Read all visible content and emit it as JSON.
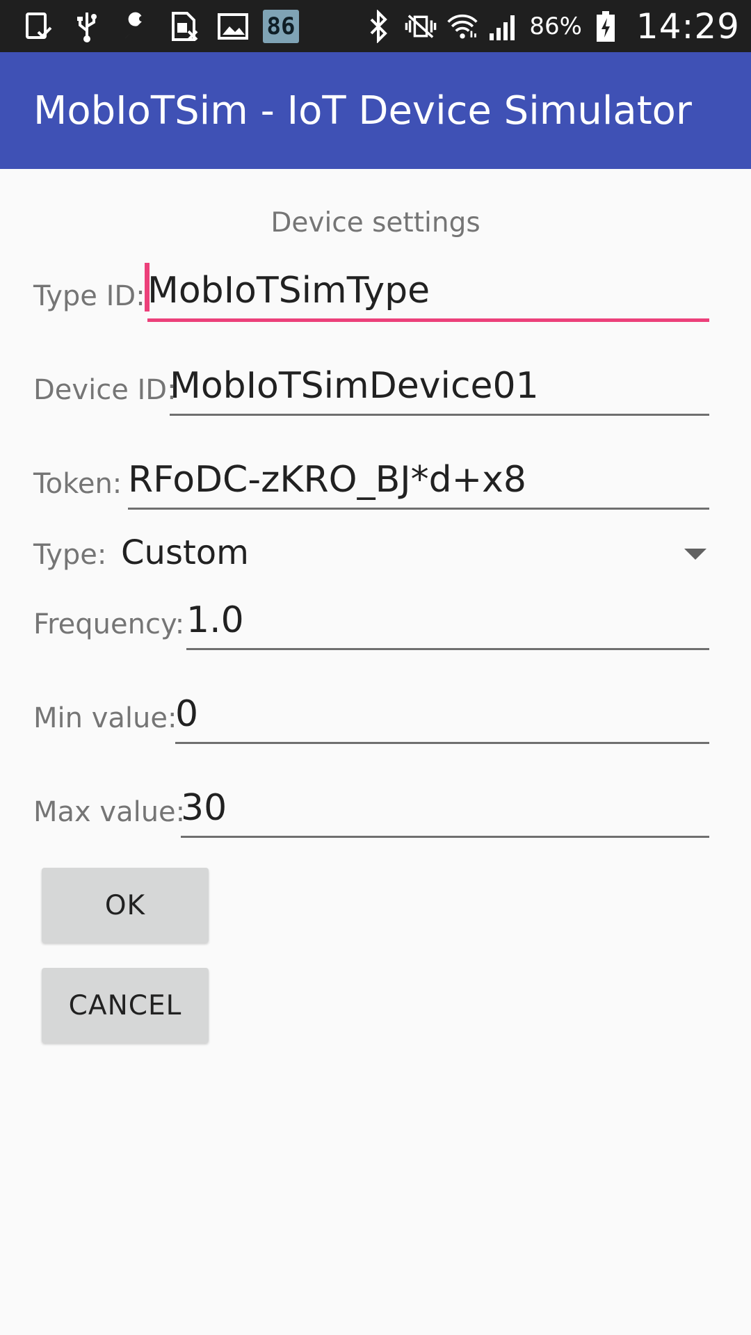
{
  "status_bar": {
    "left_icons": [
      "tablet-check-icon",
      "usb-icon",
      "wrench-icon",
      "sim-card-icon",
      "image-icon"
    ],
    "notification_badge": "86",
    "right_icons": [
      "bluetooth-icon",
      "vibrate-mute-icon",
      "wifi-icon",
      "signal-icon"
    ],
    "battery_percent": "86%",
    "battery_icon": "battery-charging-icon",
    "time": "14:29"
  },
  "app_bar": {
    "title": "MobIoTSim - IoT Device Simulator",
    "color": "#3f51b5"
  },
  "form": {
    "section_title": "Device settings",
    "type_id": {
      "label": "Type ID:",
      "value": "MobIoTSimType"
    },
    "device_id": {
      "label": "Device ID:",
      "value": "MobIoTSimDevice01"
    },
    "token": {
      "label": "Token:",
      "value": "RFoDC-zKRO_BJ*d+x8"
    },
    "type": {
      "label": "Type:",
      "value": "Custom"
    },
    "frequency": {
      "label": "Frequency:",
      "value": "1.0"
    },
    "min_value": {
      "label": "Min value:",
      "value": "0"
    },
    "max_value": {
      "label": "Max value:",
      "value": "30"
    },
    "accent_color": "#ec407a"
  },
  "buttons": {
    "ok_label": "OK",
    "cancel_label": "CANCEL"
  }
}
